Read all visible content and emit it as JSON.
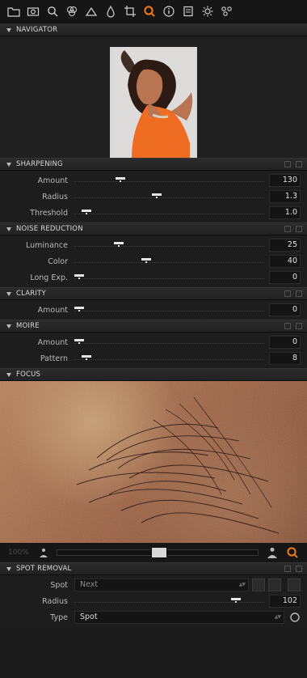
{
  "toolbar": {
    "icons": [
      {
        "name": "folder-icon"
      },
      {
        "name": "camera-icon"
      },
      {
        "name": "search-icon"
      },
      {
        "name": "layers-icon"
      },
      {
        "name": "triangle-icon"
      },
      {
        "name": "drop-icon"
      },
      {
        "name": "crop-icon"
      },
      {
        "name": "focus-icon",
        "active": true
      },
      {
        "name": "info-icon"
      },
      {
        "name": "list-icon"
      },
      {
        "name": "gear-icon"
      },
      {
        "name": "share-icon"
      }
    ],
    "active_color": "#f07a12"
  },
  "navigator": {
    "title": "NAVIGATOR"
  },
  "sharpening": {
    "title": "SHARPENING",
    "amount_label": "Amount",
    "amount_value": "130",
    "amount_fraction": 0.23,
    "radius_label": "Radius",
    "radius_value": "1.3",
    "radius_fraction": 0.43,
    "threshold_label": "Threshold",
    "threshold_value": "1.0",
    "threshold_fraction": 0.04
  },
  "noise": {
    "title": "NOISE REDUCTION",
    "luminance_label": "Luminance",
    "luminance_value": "25",
    "luminance_fraction": 0.22,
    "color_label": "Color",
    "color_value": "40",
    "color_fraction": 0.37,
    "long_label": "Long Exp.",
    "long_value": "0",
    "long_fraction": 0.0
  },
  "clarity": {
    "title": "CLARITY",
    "amount_label": "Amount",
    "amount_value": "0",
    "amount_fraction": 0.0
  },
  "moire": {
    "title": "MOIRE",
    "amount_label": "Amount",
    "amount_value": "0",
    "amount_fraction": 0.0,
    "pattern_label": "Pattern",
    "pattern_value": "8",
    "pattern_fraction": 0.04
  },
  "focus": {
    "title": "FOCUS",
    "zoom": "100%",
    "slider_fraction": 0.51
  },
  "spot_removal": {
    "title": "SPOT REMOVAL",
    "spot_label": "Spot",
    "spot_value": "Next",
    "radius_label": "Radius",
    "radius_value": "102",
    "radius_fraction": 0.87,
    "type_label": "Type",
    "type_value": "Spot"
  }
}
